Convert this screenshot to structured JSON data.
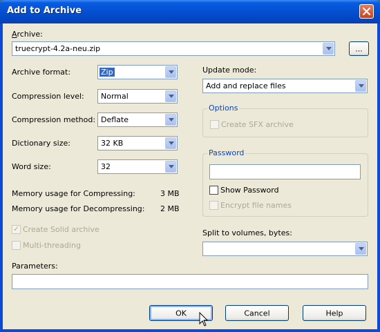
{
  "window": {
    "title": "Add to Archive"
  },
  "archive": {
    "label": "Archive:",
    "value": "truecrypt-4.2a-neu.zip",
    "browse_label": "..."
  },
  "left": {
    "archive_format": {
      "label": "Archive format:",
      "value": "Zip"
    },
    "compression_level": {
      "label": "Compression level:",
      "value": "Normal"
    },
    "compression_method": {
      "label": "Compression method:",
      "value": "Deflate"
    },
    "dictionary_size": {
      "label": "Dictionary size:",
      "value": "32 KB"
    },
    "word_size": {
      "label": "Word size:",
      "value": "32"
    },
    "mem_compress": {
      "label": "Memory usage for Compressing:",
      "value": "3 MB"
    },
    "mem_decompress": {
      "label": "Memory usage for Decompressing:",
      "value": "2 MB"
    },
    "solid_archive": {
      "label": "Create Solid archive",
      "checked": true,
      "enabled": false
    },
    "multithreading": {
      "label": "Multi-threading",
      "checked": false,
      "enabled": false
    }
  },
  "right": {
    "update_mode": {
      "label": "Update mode:",
      "value": "Add and replace files"
    },
    "options": {
      "title": "Options",
      "sfx_label": "Create SFX archive"
    },
    "password": {
      "title": "Password",
      "value": "",
      "show_label": "Show Password",
      "encrypt_names_label": "Encrypt file names"
    },
    "split": {
      "label": "Split to volumes, bytes:",
      "value": ""
    }
  },
  "parameters": {
    "label": "Parameters:",
    "value": ""
  },
  "buttons": {
    "ok": "OK",
    "cancel": "Cancel",
    "help": "Help"
  },
  "colors": {
    "title_bar": "#0553d6",
    "dialog_bg": "#ece9d8",
    "group_title": "#0046d5"
  }
}
